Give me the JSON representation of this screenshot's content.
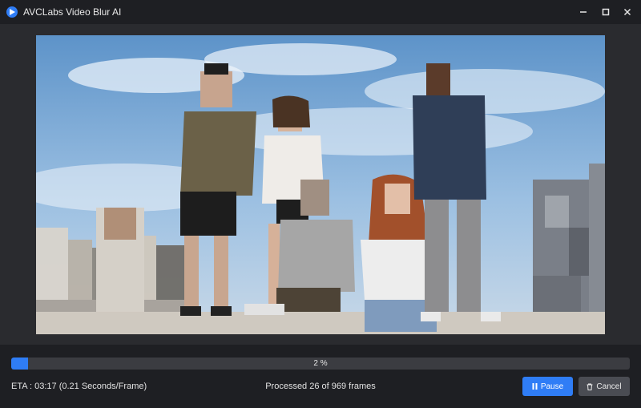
{
  "window": {
    "title": "AVCLabs Video Blur AI",
    "icon": "play-logo-icon",
    "controls": [
      "minimize-icon",
      "maximize-icon",
      "close-icon"
    ]
  },
  "preview": {
    "subject": "video frame of five people posing against a blue sky, several faces and background areas pixelated by the blur effect"
  },
  "progress": {
    "percent": 2,
    "label": "2 %",
    "color": "#2f7df6"
  },
  "status": {
    "eta": "ETA : 03:17 (0.21 Seconds/Frame)",
    "processed": "Processed 26 of 969 frames"
  },
  "buttons": {
    "pause": {
      "label": "Pause",
      "icon": "pause-icon",
      "color": "#2f7df6"
    },
    "cancel": {
      "label": "Cancel",
      "icon": "trash-icon",
      "color": "#4a4c53"
    }
  }
}
